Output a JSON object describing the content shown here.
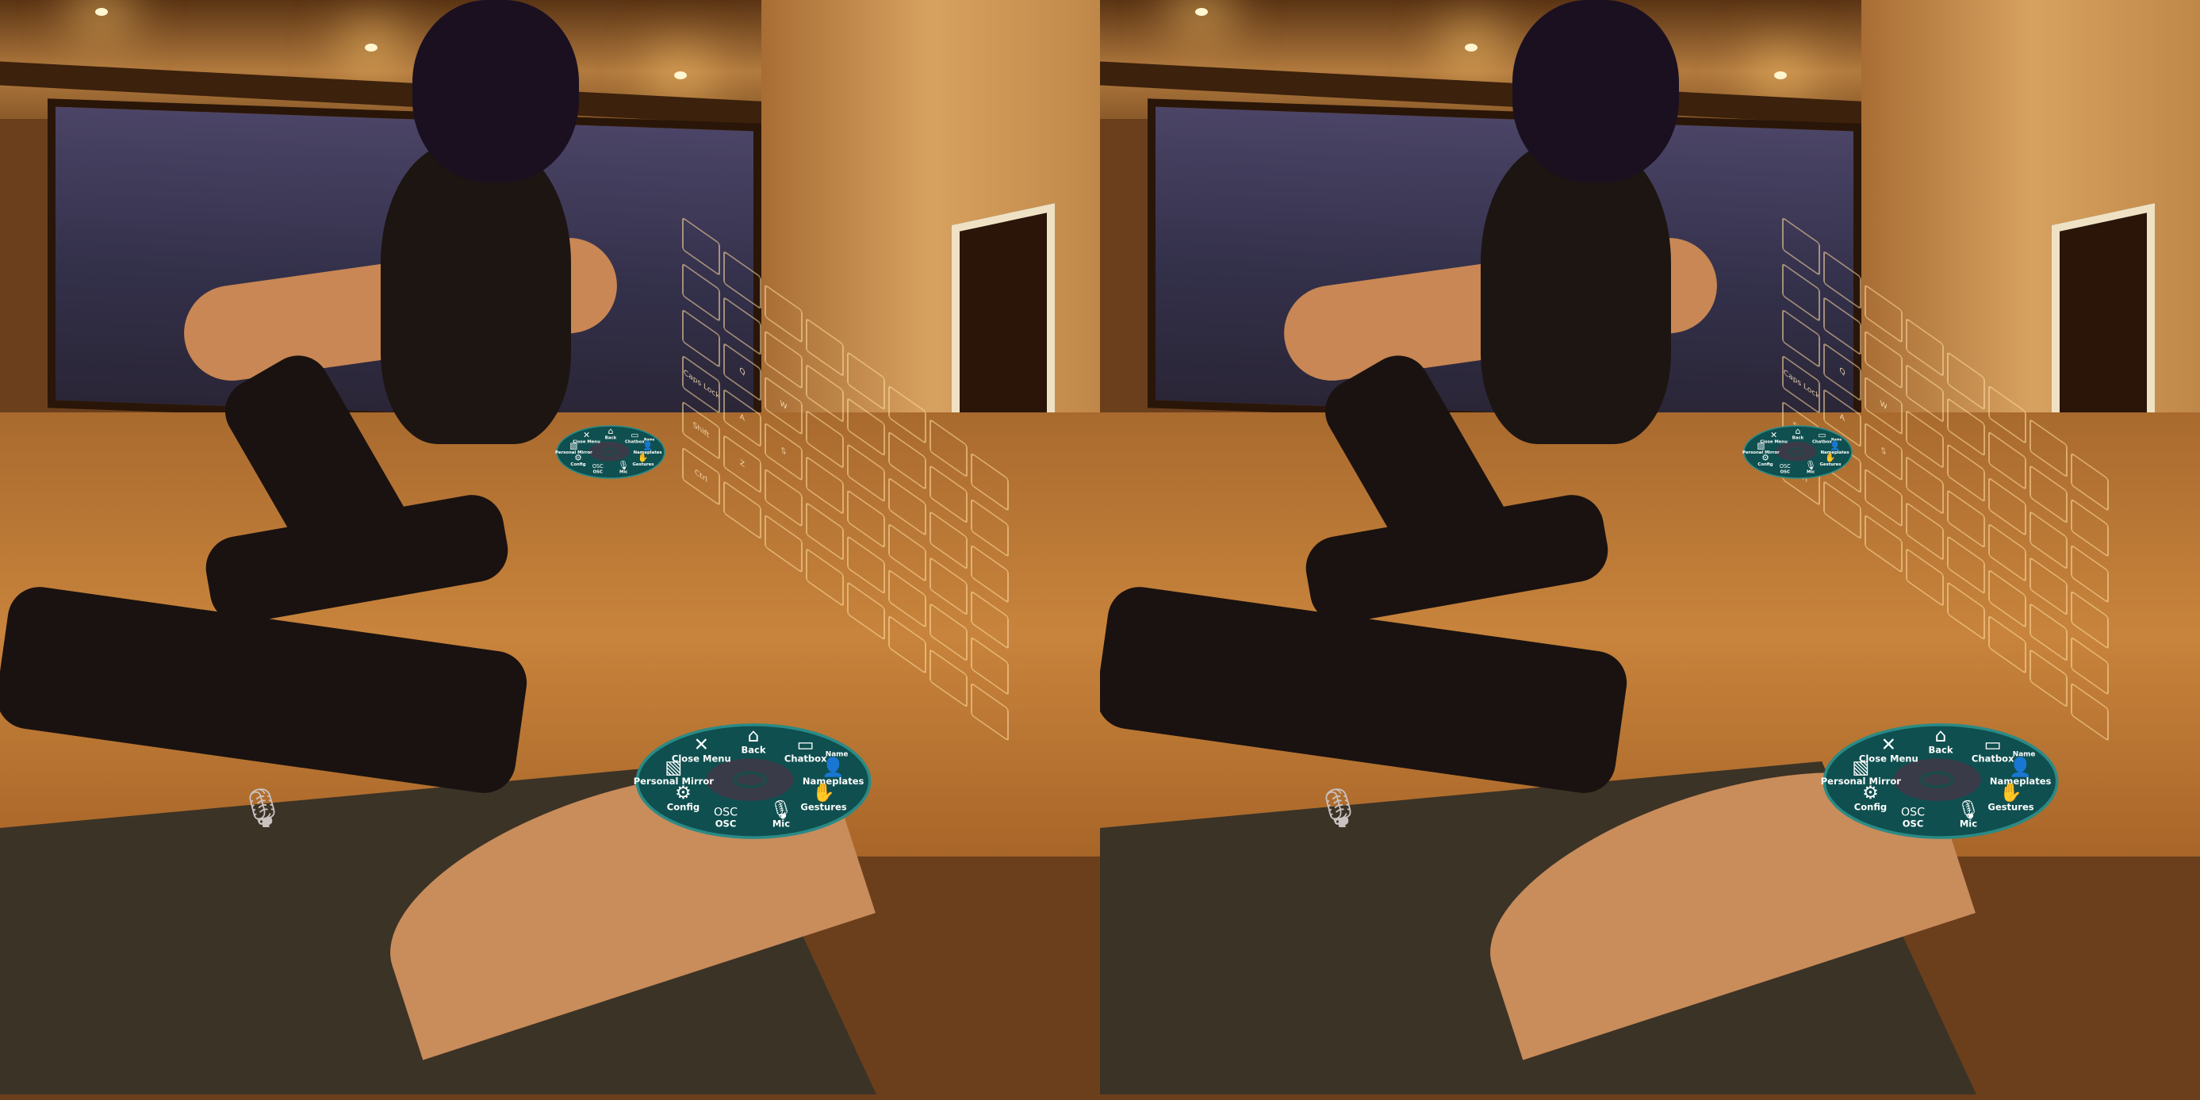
{
  "scene": {
    "app": "VRChat",
    "view": "stereo VR capture"
  },
  "action_menu": {
    "background_color": "#0f4f4f",
    "center_color": "#3a3b48",
    "items": [
      {
        "label": "Back",
        "icon": "home-back-icon",
        "glyph": "⌂"
      },
      {
        "label": "Chatbox",
        "icon": "chatbox-icon",
        "glyph": "▭"
      },
      {
        "label": "Nameplates",
        "icon": "nameplate-icon",
        "glyph": "👤",
        "badge": "Name"
      },
      {
        "label": "Gestures",
        "icon": "hand-icon",
        "glyph": "✋"
      },
      {
        "label": "Mic",
        "icon": "microphone-icon",
        "glyph": "🎙"
      },
      {
        "label": "OSC",
        "icon": "osc-icon",
        "glyph": "OSC"
      },
      {
        "label": "Config",
        "icon": "gear-icon",
        "glyph": "⚙"
      },
      {
        "label": "Personal Mirror",
        "icon": "mirror-icon",
        "glyph": "▧"
      },
      {
        "label": "Close Menu",
        "icon": "close-icon",
        "glyph": "✕"
      }
    ]
  },
  "keyboard": {
    "visible_keys": [
      "Ctrl",
      "Shift",
      "Caps Lock",
      "A",
      "S",
      "Z",
      "Q",
      "W"
    ]
  },
  "mic_indicator": {
    "icon": "microphone-icon",
    "state": "muted"
  }
}
